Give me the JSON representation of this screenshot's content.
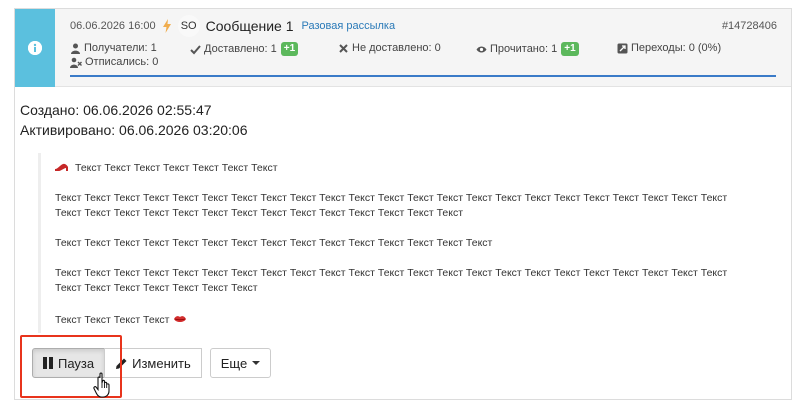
{
  "header": {
    "datetime": "06.06.2026 16:00",
    "sender": "SO",
    "title": "Сообщение 1",
    "type": "Разовая рассылка",
    "id": "#14728406",
    "stats": {
      "recipients": "Получатели: 1",
      "delivered": "Доставлено: 1",
      "delivered_badge": "+1",
      "not_delivered": "Не доставлено: 0",
      "read": "Прочитано: 1",
      "read_badge": "+1",
      "clicks": "Переходы: 0 (0%)",
      "unsubscribed": "Отписались: 0"
    },
    "colors": {
      "info_strip": "#5bc0de",
      "accent_line": "#3a7bc8",
      "badge": "#5cb85c"
    }
  },
  "details": {
    "created": "Создано: 06.06.2026 02:55:47",
    "activated": "Активировано: 06.06.2026 03:20:06"
  },
  "message": {
    "line1": "Текст Текст Текст Текст Текст Текст Текст",
    "para2a": "Текст Текст Текст Текст Текст Текст Текст Текст Текст Текст Текст Текст Текст Текст Текст Текст Текст Текст Текст Текст Текст Текст Текст",
    "para2b": "Текст Текст Текст Текст Текст Текст Текст Текст Текст Текст Текст Текст Текст Текст",
    "para3": "Текст Текст Текст Текст Текст Текст Текст Текст Текст Текст Текст Текст Текст Текст Текст",
    "para4a": "Текст Текст Текст Текст Текст Текст Текст Текст Текст Текст Текст Текст Текст Текст Текст Текст Текст Текст Текст Текст Текст Текст Текст",
    "para4b": "Текст Текст Текст Текст Текст Текст Текст",
    "line5": "Текст Текст Текст Текст",
    "icons": [
      "high-heel-shoe-emoji",
      "lips-emoji"
    ]
  },
  "actions": {
    "pause": "Пауза",
    "edit": "Изменить",
    "more": "Еще",
    "highlight_color": "#e8341c"
  }
}
